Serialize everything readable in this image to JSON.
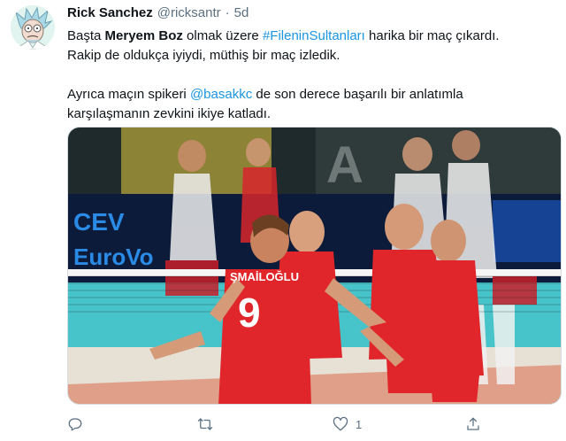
{
  "user": {
    "display_name": "Rick Sanchez",
    "handle": "@ricksantr",
    "separator": "·",
    "time": "5d"
  },
  "tweet": {
    "line1": {
      "prefix": "Başta ",
      "bold_name": "Meryem Boz",
      "middle": " olmak üzere ",
      "hashtag": "#FileninSultanları",
      "suffix": " harika bir maç çıkardı."
    },
    "line2": "Rakip de oldukça iyiydi, müthiş bir maç izledik.",
    "line3": {
      "prefix": "Ayrıca maçın spikeri ",
      "mention": "@basakkc",
      "suffix": " de son derece başarılı bir anlatımla"
    },
    "line4": "karşılaşmanın zevkini ikiye katladı."
  },
  "media": {
    "banner_cev": "CEV",
    "banner_eurovolley": "EuroVo",
    "banner_right": "A",
    "jersey_name": "ŞMAİLOĞLU",
    "jersey_number": "9",
    "colors": {
      "court": "#46c4c9",
      "floor": "#e7e1d5",
      "banner": "#0d1b3a",
      "banner_text": "#2a8be6",
      "jersey_red": "#e0262b",
      "net": "#1b1b1b"
    }
  },
  "actions": {
    "reply_icon": "reply-icon",
    "retweet_icon": "retweet-icon",
    "like_icon": "heart-icon",
    "like_count": "1",
    "share_icon": "share-icon"
  },
  "colors": {
    "link": "#1b95e0",
    "muted": "#5b7083",
    "text": "#0f1419"
  }
}
